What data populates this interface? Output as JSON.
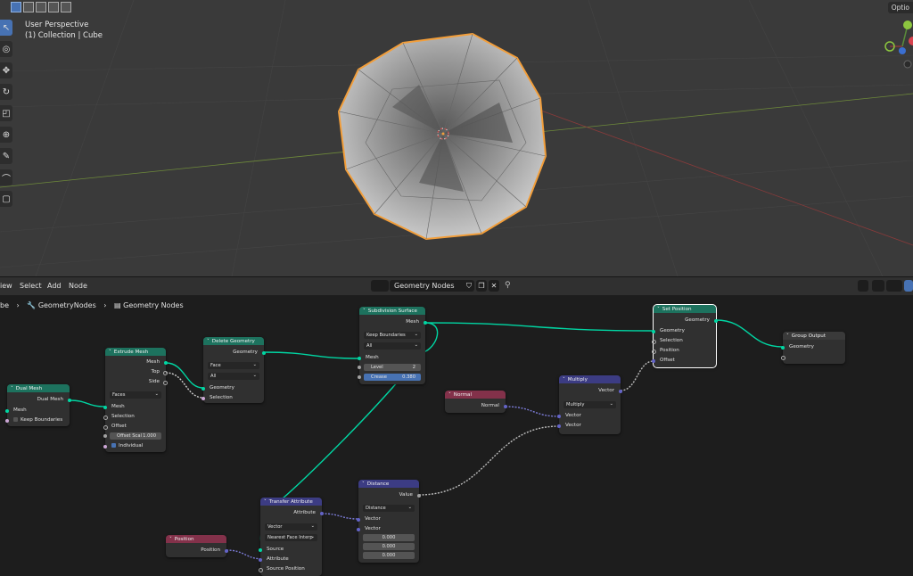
{
  "viewport": {
    "perspective_label": "User Perspective",
    "collection_label": "(1) Collection | Cube",
    "options_label": "Optio"
  },
  "node_editor": {
    "menu": [
      "iew",
      "Select",
      "Add",
      "Node"
    ],
    "tree_name": "Geometry Nodes",
    "breadcrumb": {
      "first": "be",
      "modifier": "GeometryNodes",
      "tree": "Geometry Nodes"
    }
  },
  "nodes": {
    "dual_mesh": {
      "title": "Dual Mesh",
      "out": "Dual Mesh",
      "in_mesh": "Mesh",
      "keep_boundaries": "Keep Boundaries"
    },
    "extrude_mesh": {
      "title": "Extrude Mesh",
      "out_mesh": "Mesh",
      "out_top": "Top",
      "out_side": "Side",
      "mode": "Faces",
      "in_mesh": "Mesh",
      "in_selection": "Selection",
      "in_offset": "Offset",
      "offset_scale_label": "Offset Scal",
      "offset_scale_value": "1.000",
      "individual": "Individual"
    },
    "delete_geometry": {
      "title": "Delete Geometry",
      "out": "Geometry",
      "domain": "Face",
      "mode": "All",
      "in_geometry": "Geometry",
      "in_selection": "Selection"
    },
    "subdivision_surface": {
      "title": "Subdivision Surface",
      "out": "Mesh",
      "boundary": "Keep Boundaries",
      "uv": "All",
      "in_mesh": "Mesh",
      "level_label": "Level",
      "level_value": "2",
      "crease_label": "Crease",
      "crease_value": "0.380"
    },
    "set_position": {
      "title": "Set Position",
      "out": "Geometry",
      "in_geometry": "Geometry",
      "in_selection": "Selection",
      "in_position": "Position",
      "in_offset": "Offset"
    },
    "group_output": {
      "title": "Group Output",
      "in_geometry": "Geometry"
    },
    "normal": {
      "title": "Normal",
      "out": "Normal"
    },
    "multiply": {
      "title": "Multiply",
      "out": "Vector",
      "op": "Multiply",
      "in_a": "Vector",
      "in_b": "Vector"
    },
    "distance": {
      "title": "Distance",
      "out": "Value",
      "op": "Distance",
      "in_a": "Vector",
      "in_b": "Vector",
      "v1": "0.000",
      "v2": "0.000",
      "v3": "0.000"
    },
    "transfer_attribute": {
      "title": "Transfer Attribute",
      "out": "Attribute",
      "type": "Vector",
      "mapping": "Nearest Face Interp",
      "in_source": "Source",
      "in_attribute": "Attribute",
      "in_source_position": "Source Position"
    },
    "position": {
      "title": "Position",
      "out": "Position"
    }
  },
  "colors": {
    "geometry_header": "#1d725e",
    "input_header": "#83314a",
    "vector_header": "#3c3c83",
    "geometry_socket": "#00d6a3",
    "vector_socket": "#6363c7",
    "selection_outline": "#f29e3a"
  }
}
